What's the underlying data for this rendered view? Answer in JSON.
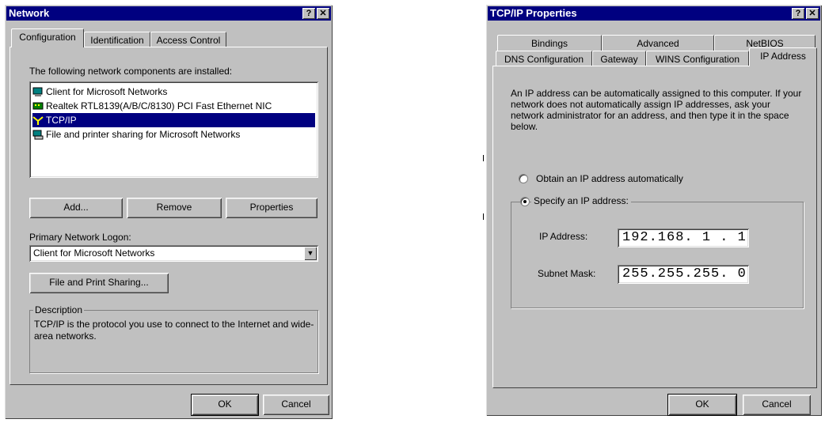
{
  "network": {
    "title": "Network",
    "help_btn": "?",
    "close_btn": "✕",
    "tabs": [
      "Configuration",
      "Identification",
      "Access Control"
    ],
    "components_label": "The following network components are installed:",
    "components": [
      {
        "label": "Client for Microsoft Networks",
        "icon": "client-icon",
        "selected": false
      },
      {
        "label": "Realtek RTL8139(A/B/C/8130) PCI Fast Ethernet NIC",
        "icon": "network-card-icon",
        "selected": false
      },
      {
        "label": "TCP/IP",
        "icon": "protocol-icon",
        "selected": true
      },
      {
        "label": "File and printer sharing for Microsoft Networks",
        "icon": "file-sharing-icon",
        "selected": false
      }
    ],
    "add_btn": "Add...",
    "remove_btn": "Remove",
    "properties_btn": "Properties",
    "logon_label": "Primary Network Logon:",
    "logon_value": "Client for Microsoft Networks",
    "file_print_btn": "File and Print Sharing...",
    "description_label": "Description",
    "description_text": "TCP/IP is the protocol you use to connect to the Internet and wide-area networks.",
    "ok_btn": "OK",
    "cancel_btn": "Cancel"
  },
  "tcpip": {
    "title": "TCP/IP Properties",
    "help_btn": "?",
    "close_btn": "✕",
    "tabs_back": [
      "Bindings",
      "Advanced",
      "NetBIOS"
    ],
    "tabs_front": [
      "DNS Configuration",
      "Gateway",
      "WINS Configuration",
      "IP Address"
    ],
    "intro": "An IP address can be automatically assigned to this computer. If your network does not automatically assign IP addresses, ask your network administrator for an address, and then type it in the space below.",
    "obtain_auto": "Obtain an IP address automatically",
    "specify": "Specify an IP address:",
    "ip_label": "IP Address:",
    "ip_value": "192.168. 1 . 1",
    "subnet_label": "Subnet Mask:",
    "subnet_value": "255.255.255. 0",
    "ok_btn": "OK",
    "cancel_btn": "Cancel"
  },
  "colors": {
    "title_bar": "#000080",
    "face": "#c0c0c0",
    "selection": "#000080"
  }
}
